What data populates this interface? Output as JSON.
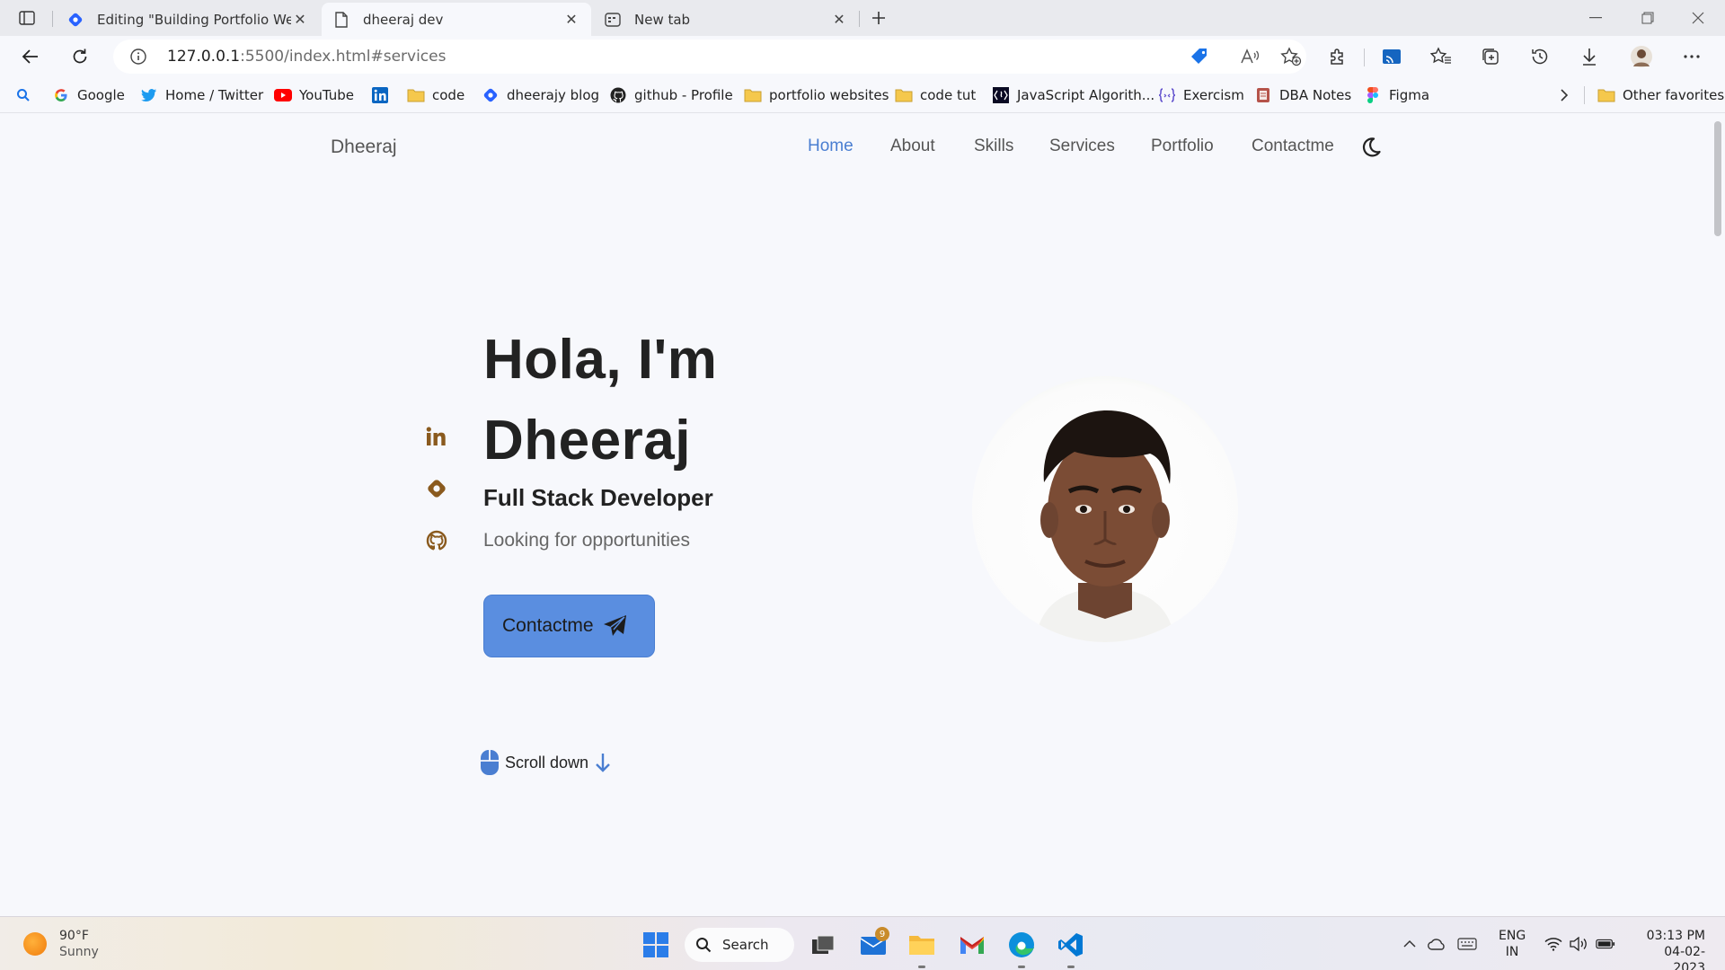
{
  "browser": {
    "tabs": [
      {
        "title": "Editing \"Building Portfolio Website",
        "active": false
      },
      {
        "title": "dheeraj dev",
        "active": true
      },
      {
        "title": "New tab",
        "active": false
      }
    ],
    "address": {
      "host": "127.0.0.1",
      "path": ":5500/index.html#services"
    },
    "bookmarks": [
      {
        "label": "Google",
        "icon": "google-icon"
      },
      {
        "label": "Home / Twitter",
        "icon": "twitter-icon"
      },
      {
        "label": "YouTube",
        "icon": "youtube-icon"
      },
      {
        "label": "",
        "icon": "linkedin-icon"
      },
      {
        "label": "code",
        "icon": "folder-icon"
      },
      {
        "label": "dheerajy blog",
        "icon": "hashnode-icon"
      },
      {
        "label": "github - Profile",
        "icon": "github-icon"
      },
      {
        "label": "portfolio websites",
        "icon": "folder-icon"
      },
      {
        "label": "code tut",
        "icon": "folder-icon"
      },
      {
        "label": "JavaScript Algorith...",
        "icon": "freecodecamp-icon"
      },
      {
        "label": "Exercism",
        "icon": "exercism-icon"
      },
      {
        "label": "DBA Notes",
        "icon": "notes-icon"
      },
      {
        "label": "Figma",
        "icon": "figma-icon"
      },
      {
        "label": "Other favorites",
        "icon": "folder-icon"
      }
    ]
  },
  "site": {
    "logo": "Dheeraj",
    "nav": [
      "Home",
      "About",
      "Skills",
      "Services",
      "Portfolio",
      "Contactme"
    ],
    "active_nav": "Home",
    "hero": {
      "line1": "Hola, I'm",
      "line2": "Dheeraj",
      "subtitle": "Full Stack Developer",
      "description": "Looking for opportunities",
      "cta": "Contactme"
    },
    "scroll_label": "Scroll down",
    "colors": {
      "accent": "#4a7ed1",
      "button": "#5a8ee0",
      "social": "#8a5a1e"
    }
  },
  "taskbar": {
    "weather": {
      "temp": "90°F",
      "condition": "Sunny"
    },
    "search_label": "Search",
    "mail_badge": "9",
    "lang": {
      "line1": "ENG",
      "line2": "IN"
    },
    "time": "03:13 PM",
    "date": "04-02-2023"
  }
}
